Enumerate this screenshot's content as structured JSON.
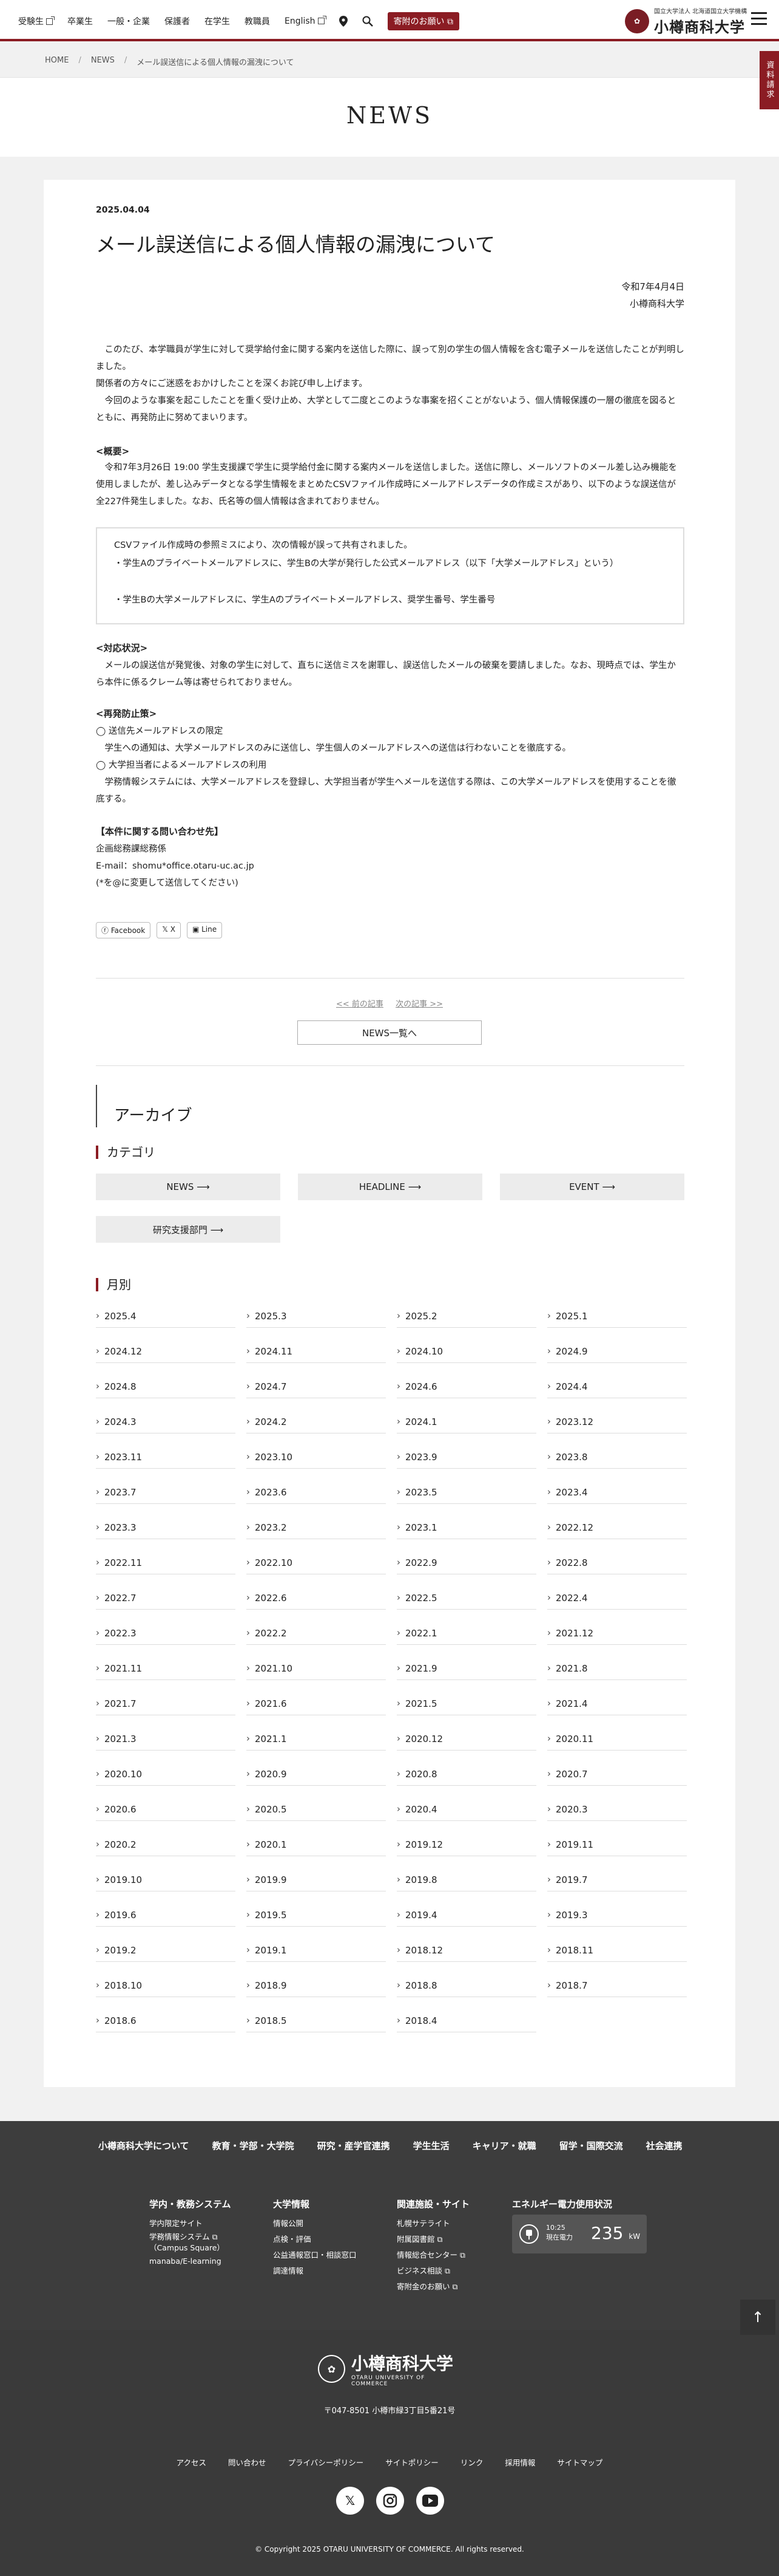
{
  "header": {
    "nav": [
      "受験生",
      "卒業生",
      "一般・企業",
      "保護者",
      "在学生",
      "教職員",
      "English"
    ],
    "nav_ext": [
      true,
      false,
      false,
      false,
      false,
      false,
      true
    ],
    "donate": "寄附のお願い",
    "logo_sub": "国立大学法人 北海道国立大学機構",
    "logo_main": "小樽商科大学",
    "side_tab": "資料請求",
    "brand_color": "#8b1c23"
  },
  "breadcrumb": [
    "HOME",
    "NEWS",
    "メール誤送信による個人情報の漏洩について"
  ],
  "page_title": "NEWS",
  "article": {
    "date": "2025.04.04",
    "title": "メール誤送信による個人情報の漏洩について",
    "date_jp": "令和7年4月4日",
    "issuer": "小樽商科大学",
    "intro1": "　このたび、本学職員が学生に対して奨学給付金に関する案内を送信した際に、誤って別の学生の個人情報を含む電子メールを送信したことが判明しました。",
    "intro2": "関係者の方々にご迷惑をおかけしたことを深くお詫び申し上げます。",
    "intro3": "　今回のような事案を起こしたことを重く受け止め、大学として二度とこのような事案を招くことがないよう、個人情報保護の一層の徹底を図るとともに、再発防止に努めてまいります。",
    "h_overview": "<概要>",
    "overview": "　令和7年3月26日 19:00 学生支援課で学生に奨学給付金に関する案内メールを送信しました。送信に際し、メールソフトのメール差し込み機能を使用しましたが、差し込みデータとなる学生情報をまとめたCSVファイル作成時にメールアドレスデータの作成ミスがあり、以下のような誤送信が全227件発生しました。なお、氏名等の個人情報は含まれておりません。",
    "box1": "CSVファイル作成時の参照ミスにより、次の情報が誤って共有されました。",
    "box2": "・学生Aのプライベートメールアドレスに、学生Bの大学が発行した公式メールアドレス（以下「大学メールアドレス」という）",
    "box3": "・学生Bの大学メールアドレスに、学生Aのプライベートメールアドレス、奨学生番号、学生番号",
    "h_response": "<対応状況>",
    "response": "　メールの誤送信が発覚後、対象の学生に対して、直ちに送信ミスを謝罪し、誤送信したメールの破棄を要請しました。なお、現時点では、学生から本件に係るクレーム等は寄せられておりません。",
    "h_prevent": "<再発防止策>",
    "prev1": "◯ 送信先メールアドレスの限定",
    "prev2": "　学生への通知は、大学メールアドレスのみに送信し、学生個人のメールアドレスへの送信は行わないことを徹底する。",
    "prev3": "◯ 大学担当者によるメールアドレスの利用",
    "prev4": "　学務情報システムには、大学メールアドレスを登録し、大学担当者が学生へメールを送信する際は、この大学メールアドレスを使用することを徹底する。",
    "h_contact": "【本件に関する問い合わせ先】",
    "contact1": "企画総務課総務係",
    "contact2": "E-mail：shomu*office.otaru-uc.ac.jp",
    "contact3": "(*を@に変更して送信してください)"
  },
  "share": [
    "Facebook",
    "X",
    "Line"
  ],
  "pager": {
    "prev": "<< 前の記事",
    "next": "次の記事 >>",
    "list": "NEWS一覧へ"
  },
  "archive": {
    "title": "アーカイブ",
    "cat_title": "カテゴリ",
    "categories": [
      "NEWS ⟶",
      "HEADLINE ⟶",
      "EVENT ⟶",
      "研究支援部門 ⟶"
    ],
    "month_title": "月別",
    "months": [
      "2025.4",
      "2025.3",
      "2025.2",
      "2025.1",
      "2024.12",
      "2024.11",
      "2024.10",
      "2024.9",
      "2024.8",
      "2024.7",
      "2024.6",
      "2024.4",
      "2024.3",
      "2024.2",
      "2024.1",
      "2023.12",
      "2023.11",
      "2023.10",
      "2023.9",
      "2023.8",
      "2023.7",
      "2023.6",
      "2023.5",
      "2023.4",
      "2023.3",
      "2023.2",
      "2023.1",
      "2022.12",
      "2022.11",
      "2022.10",
      "2022.9",
      "2022.8",
      "2022.7",
      "2022.6",
      "2022.5",
      "2022.4",
      "2022.3",
      "2022.2",
      "2022.1",
      "2021.12",
      "2021.11",
      "2021.10",
      "2021.9",
      "2021.8",
      "2021.7",
      "2021.6",
      "2021.5",
      "2021.4",
      "2021.3",
      "2021.1",
      "2020.12",
      "2020.11",
      "2020.10",
      "2020.9",
      "2020.8",
      "2020.7",
      "2020.6",
      "2020.5",
      "2020.4",
      "2020.3",
      "2020.2",
      "2020.1",
      "2019.12",
      "2019.11",
      "2019.10",
      "2019.9",
      "2019.8",
      "2019.7",
      "2019.6",
      "2019.5",
      "2019.4",
      "2019.3",
      "2019.2",
      "2019.1",
      "2018.12",
      "2018.11",
      "2018.10",
      "2018.9",
      "2018.8",
      "2018.7",
      "2018.6",
      "2018.5",
      "2018.4"
    ]
  },
  "footer": {
    "nav": [
      "小樽商科大学について",
      "教育・学部・大学院",
      "研究・産学官連携",
      "学生生活",
      "キャリア・就職",
      "留学・国際交流",
      "社会連携"
    ],
    "col1_title": "学内・教務システム",
    "col1": [
      "学内限定サイト",
      "学務情報システム",
      "（Campus Square）",
      "manaba/E-learning"
    ],
    "col2_title": "大学情報",
    "col2": [
      "情報公開",
      "点検・評価",
      "公益通報窓口・相談窓口",
      "調達情報"
    ],
    "col3_title": "関連施設・サイト",
    "col3": [
      "札幌サテライト",
      "附属図書館",
      "情報総合センター",
      "ビジネス相談",
      "寄附金のお願い"
    ],
    "energy_title": "エネルギー電力使用状況",
    "energy_time": "10:25",
    "energy_label": "現在電力",
    "energy_value": "235",
    "energy_unit": "kW",
    "logo_main": "小樽商科大学",
    "logo_sub": "OTARU UNIVERSITY OF COMMERCE",
    "address": "〒047-8501 小樽市緑3丁目5番21号",
    "links": [
      "アクセス",
      "問い合わせ",
      "プライバシーポリシー",
      "サイトポリシー",
      "リンク",
      "採用情報",
      "サイトマップ"
    ],
    "social": [
      "X",
      "instagram",
      "youtube"
    ],
    "copyright": "© Copyright 2025 OTARU UNIVERSITY OF COMMERCE. All rights reserved."
  }
}
